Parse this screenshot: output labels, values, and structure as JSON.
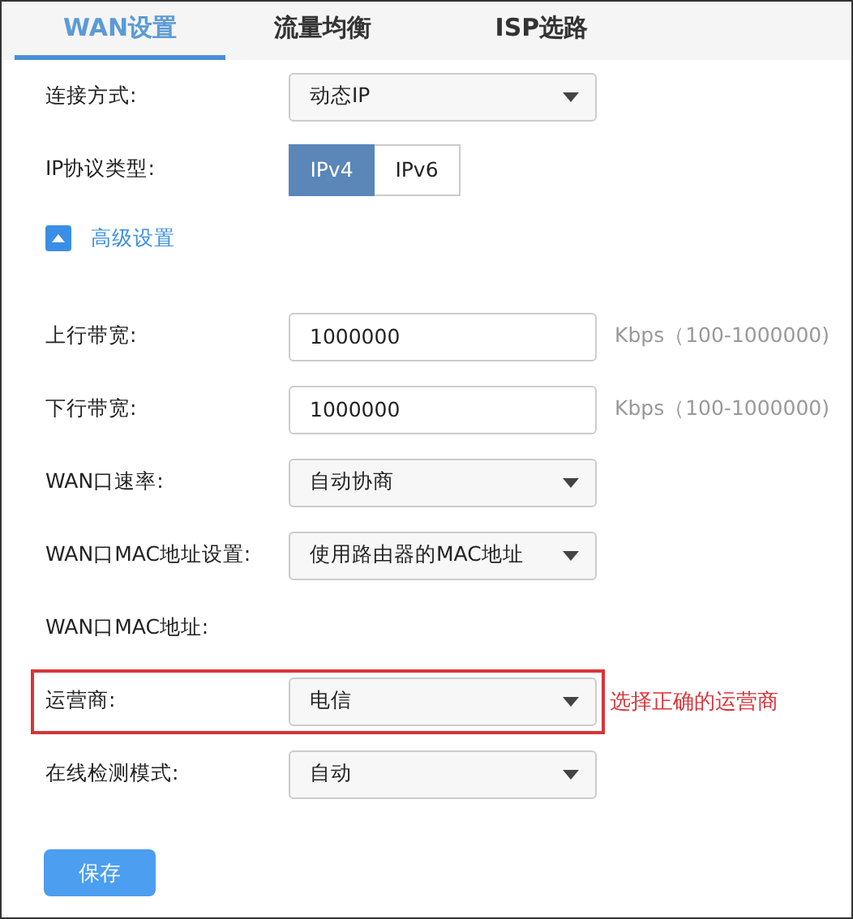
{
  "tabs": [
    {
      "label": "WAN设置",
      "selected": true
    },
    {
      "label": "流量均衡",
      "selected": false
    },
    {
      "label": "ISP选路",
      "selected": false
    }
  ],
  "rows": [
    {
      "kind": "select",
      "label": "连接方式:",
      "value": "动态IP"
    },
    {
      "kind": "segmented",
      "label": "IP协议类型:",
      "options": [
        {
          "label": "IPv4",
          "selected": true
        },
        {
          "label": "IPv6",
          "selected": false
        }
      ]
    },
    {
      "kind": "toggle",
      "label": "高级设置",
      "expanded": true
    },
    {
      "kind": "input",
      "label": "上行带宽:",
      "value": "1000000",
      "hint": "Kbps（100-1000000)"
    },
    {
      "kind": "input",
      "label": "下行带宽:",
      "value": "1000000",
      "hint": "Kbps（100-1000000)"
    },
    {
      "kind": "select",
      "label": "WAN口速率:",
      "value": "自动协商"
    },
    {
      "kind": "select",
      "label": "WAN口MAC地址设置:",
      "value": "使用路由器的MAC地址"
    },
    {
      "kind": "text",
      "label": "WAN口MAC地址:"
    },
    {
      "kind": "select",
      "label": "运营商:",
      "value": "电信",
      "highlighted": true,
      "note": "选择正确的运营商"
    },
    {
      "kind": "select",
      "label": "在线检测模式:",
      "value": "自动"
    }
  ],
  "save_button": "保存"
}
